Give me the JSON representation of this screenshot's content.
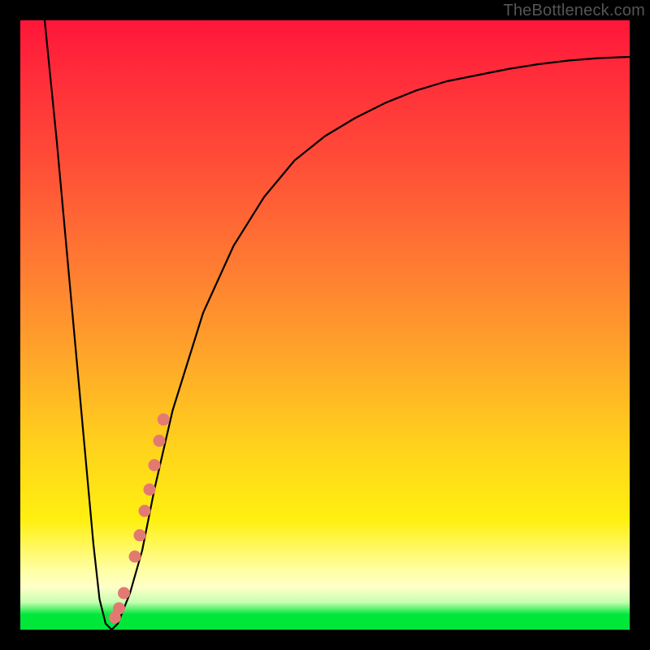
{
  "watermark": "TheBottleneck.com",
  "chart_data": {
    "type": "line",
    "title": "",
    "xlabel": "",
    "ylabel": "",
    "xlim": [
      0,
      100
    ],
    "ylim": [
      0,
      100
    ],
    "grid": false,
    "legend": false,
    "series": [
      {
        "name": "bottleneck-curve",
        "x": [
          4,
          6,
          8,
          10,
          12,
          13,
          14,
          15,
          16,
          18,
          20,
          22,
          25,
          30,
          35,
          40,
          45,
          50,
          55,
          60,
          65,
          70,
          75,
          80,
          85,
          90,
          95,
          100
        ],
        "y": [
          100,
          80,
          58,
          36,
          14,
          5,
          1,
          0,
          1,
          6,
          13,
          23,
          36,
          52,
          63,
          71,
          77,
          81,
          84,
          86.5,
          88.5,
          90,
          91,
          92,
          92.8,
          93.4,
          93.8,
          94
        ]
      },
      {
        "name": "highlight-dots",
        "type": "scatter",
        "x": [
          15.5,
          16.2,
          17.0,
          18.8,
          19.6,
          20.4,
          21.2,
          22.0,
          22.8,
          23.5
        ],
        "y": [
          2.0,
          3.5,
          6.0,
          12.0,
          15.5,
          19.5,
          23.0,
          27.0,
          31.0,
          34.5
        ]
      }
    ],
    "gradient_stops": [
      {
        "pos": 0.0,
        "color": "#ff163a"
      },
      {
        "pos": 0.4,
        "color": "#ff7a32"
      },
      {
        "pos": 0.7,
        "color": "#ffd21c"
      },
      {
        "pos": 0.905,
        "color": "#ffffa8"
      },
      {
        "pos": 0.955,
        "color": "#c6ffb0"
      },
      {
        "pos": 0.975,
        "color": "#00e73a"
      },
      {
        "pos": 1.0,
        "color": "#00e73a"
      }
    ]
  }
}
